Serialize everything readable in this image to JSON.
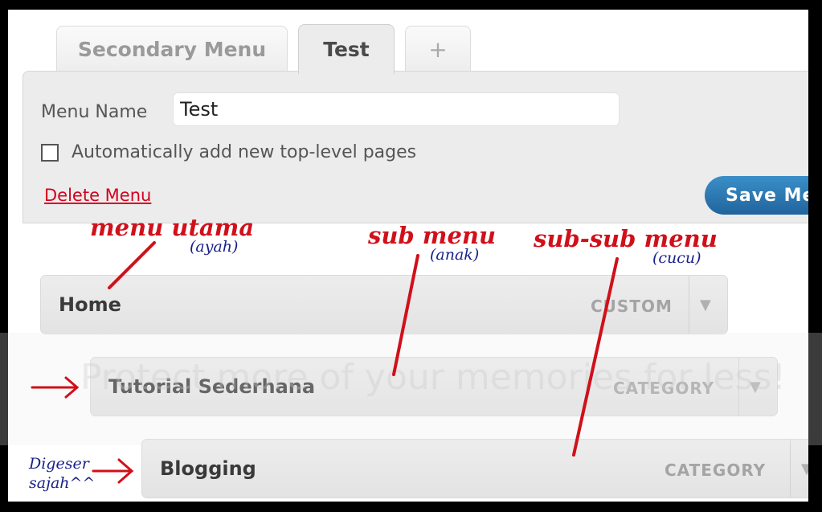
{
  "tabs": [
    {
      "label": "Secondary Menu"
    },
    {
      "label": "Test"
    },
    {
      "label": "+"
    }
  ],
  "form": {
    "menu_name_label": "Menu Name",
    "menu_name_value": "Test",
    "auto_add_label": "Automatically add new top-level pages",
    "auto_add_checked": false,
    "delete_label": "Delete Menu",
    "save_label": "Save Me"
  },
  "menu_items": [
    {
      "title": "Home",
      "type": "CUSTOM"
    },
    {
      "title": "Tutorial Sederhana",
      "type": "CATEGORY"
    },
    {
      "title": "Blogging",
      "type": "CATEGORY"
    }
  ],
  "watermark": "Protect more of your memories for less!",
  "annotations": {
    "menu_utama": "menu utama",
    "ayah": "(ayah)",
    "sub_menu": "sub menu",
    "anak": "(anak)",
    "sub_sub_menu": "sub-sub menu",
    "cucu": "(cucu)",
    "digeser_1": "Digeser",
    "digeser_2": "sajah^^"
  },
  "colors": {
    "annotation_red": "#d0101a",
    "annotation_blue": "#18208a",
    "save_button": "#2a78b4",
    "delete_link": "#d5001c"
  }
}
